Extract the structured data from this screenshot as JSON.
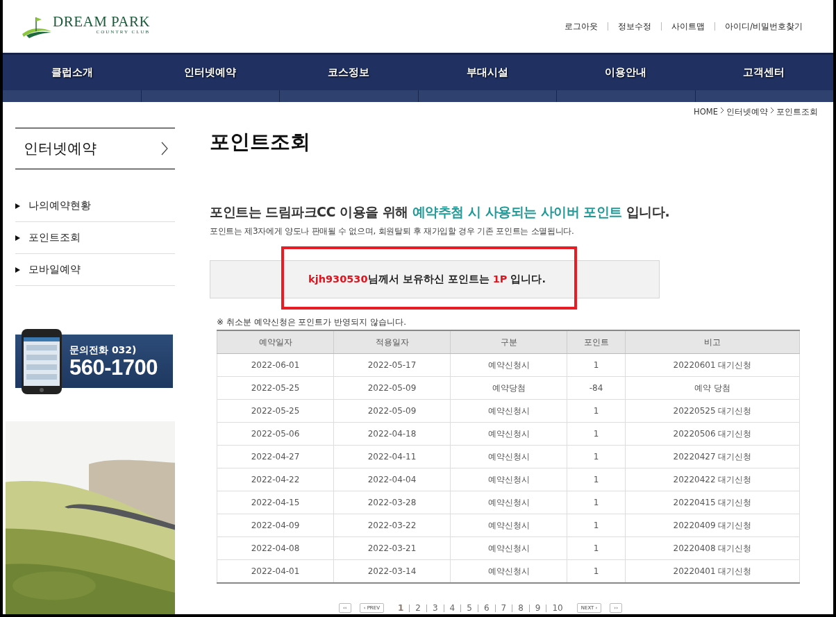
{
  "logo": {
    "name": "DREAM PARK",
    "sub": "COUNTRY CLUB"
  },
  "top_links": [
    "로그아웃",
    "정보수정",
    "사이트맵",
    "아이디/비밀번호찾기"
  ],
  "nav": [
    "클럽소개",
    "인터넷예약",
    "코스정보",
    "부대시설",
    "이용안내",
    "고객센터"
  ],
  "breadcrumb": [
    "HOME",
    "인터넷예약",
    "포인트조회"
  ],
  "sidebar": {
    "title": "인터넷예약",
    "items": [
      {
        "label": "나의예약현황",
        "selected": false
      },
      {
        "label": "포인트조회",
        "selected": false
      },
      {
        "label": "모바일예약",
        "selected": false
      }
    ],
    "banner": {
      "label": "문의전화",
      "area": "032)",
      "number": "560-1700"
    }
  },
  "page_title": "포인트조회",
  "intro": {
    "before": "포인트는 드림파크CC 이용을 위해 ",
    "highlight": "예약추첨 시 사용되는 사이버 포인트",
    "after": " 입니다.",
    "note": "포인트는 제3자에게 양도나 판매될 수 없으며, 회원탈퇴 후 재가입할 경우 기존 포인트는 소멸됩니다."
  },
  "points_box": {
    "user_id": "kjh930530",
    "middle": "님께서 보유하신 포인트는 ",
    "points": "1P",
    "end": " 입니다."
  },
  "table_note": "※ 취소분 예약신청은 포인트가 반영되지 않습니다.",
  "table": {
    "columns": [
      "예약일자",
      "적용일자",
      "구분",
      "포인트",
      "비고"
    ],
    "rows": [
      [
        "2022-06-01",
        "2022-05-17",
        "예약신청시",
        "1",
        "20220601 대기신청"
      ],
      [
        "2022-05-25",
        "2022-05-09",
        "예약당첨",
        "-84",
        "예약 당첨"
      ],
      [
        "2022-05-25",
        "2022-05-09",
        "예약신청시",
        "1",
        "20220525 대기신청"
      ],
      [
        "2022-05-06",
        "2022-04-18",
        "예약신청시",
        "1",
        "20220506 대기신청"
      ],
      [
        "2022-04-27",
        "2022-04-11",
        "예약신청시",
        "1",
        "20220427 대기신청"
      ],
      [
        "2022-04-22",
        "2022-04-04",
        "예약신청시",
        "1",
        "20220422 대기신청"
      ],
      [
        "2022-04-15",
        "2022-03-28",
        "예약신청시",
        "1",
        "20220415 대기신청"
      ],
      [
        "2022-04-09",
        "2022-03-22",
        "예약신청시",
        "1",
        "20220409 대기신청"
      ],
      [
        "2022-04-08",
        "2022-03-21",
        "예약신청시",
        "1",
        "20220408 대기신청"
      ],
      [
        "2022-04-01",
        "2022-03-14",
        "예약신청시",
        "1",
        "20220401 대기신청"
      ]
    ]
  },
  "pagination": {
    "first": "‹‹",
    "prev": "‹ PREV",
    "next": "NEXT ›",
    "last": "››",
    "pages": [
      {
        "label": "1",
        "selected": true
      },
      {
        "label": "2",
        "selected": false
      },
      {
        "label": "3",
        "selected": false
      },
      {
        "label": "4",
        "selected": false
      },
      {
        "label": "5",
        "selected": false
      },
      {
        "label": "6",
        "selected": false
      },
      {
        "label": "7",
        "selected": false
      },
      {
        "label": "8",
        "selected": false
      },
      {
        "label": "9",
        "selected": false
      },
      {
        "label": "10",
        "selected": false
      }
    ]
  }
}
